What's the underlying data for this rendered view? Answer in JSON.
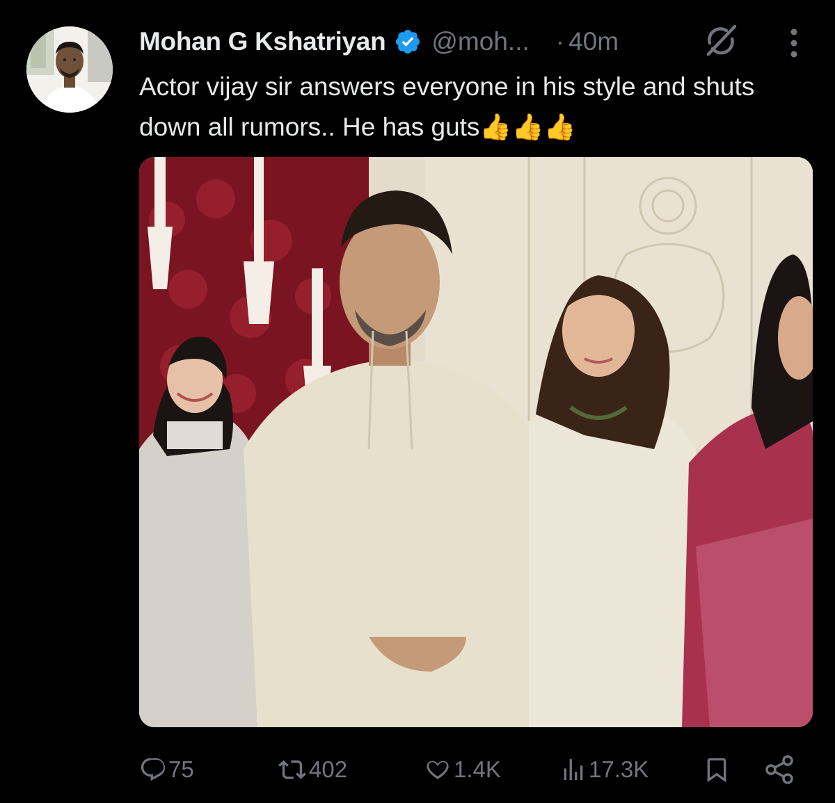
{
  "tweet": {
    "author_name": "Mohan G Kshatriyan",
    "handle": "@moh...",
    "separator": "·",
    "time": "40m",
    "text": "Actor vijay sir answers everyone in his style and shuts down all rumors.. He has guts👍👍👍",
    "icons": {
      "verified": "verified-badge-icon",
      "grok": "grok-icon",
      "more": "more-options-icon"
    },
    "media": {
      "type": "photo",
      "description_icon": "photo"
    }
  },
  "actions": {
    "replies": {
      "icon": "reply-icon",
      "count": "75"
    },
    "reposts": {
      "icon": "repost-icon",
      "count": "402"
    },
    "likes": {
      "icon": "like-icon",
      "count": "1.4K"
    },
    "views": {
      "icon": "views-icon",
      "count": "17.3K"
    },
    "bookmark": {
      "icon": "bookmark-icon"
    },
    "share": {
      "icon": "share-icon"
    }
  },
  "colors": {
    "background": "#000000",
    "primary_text": "#e7e9ea",
    "secondary_text": "#71767b",
    "verified_blue": "#1d9bf0"
  }
}
